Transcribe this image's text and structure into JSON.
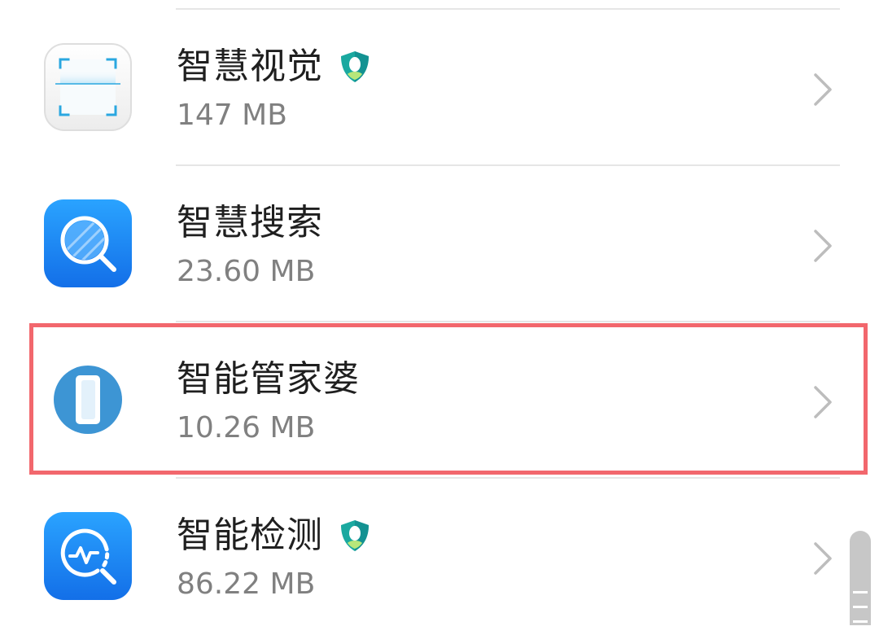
{
  "apps": [
    {
      "name": "智慧视觉",
      "size": "147 MB",
      "icon": "smart-vision-scan-icon",
      "verified": true
    },
    {
      "name": "智慧搜索",
      "size": "23.60 MB",
      "icon": "smart-search-magnifier-icon",
      "verified": false
    },
    {
      "name": "智能管家婆",
      "size": "10.26 MB",
      "icon": "smart-butler-icon",
      "verified": false
    },
    {
      "name": "智能检测",
      "size": "86.22 MB",
      "icon": "smart-detection-icon",
      "verified": true
    }
  ],
  "colors": {
    "highlight": "#f2676d",
    "badge_teal": "#1aa9a0",
    "search_blue": "#1e8cf5",
    "butler_blue": "#3d95d4",
    "chevron": "#bdbdbd"
  }
}
